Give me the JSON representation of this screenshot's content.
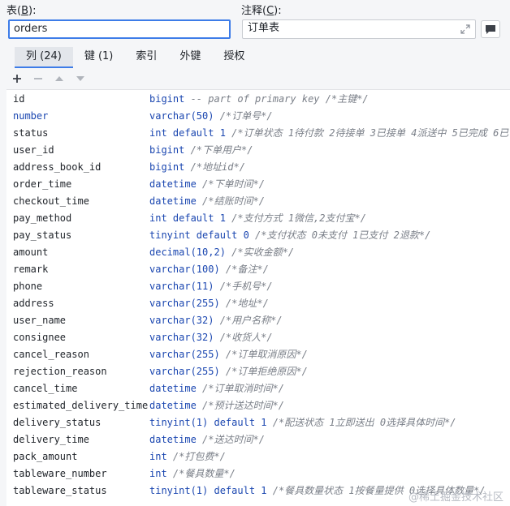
{
  "table_label_prefix": "表(",
  "table_label_key": "B",
  "table_label_suffix": "):",
  "comment_label_prefix": "注释(",
  "comment_label_key": "C",
  "comment_label_suffix": "):",
  "table_value": "orders",
  "comment_value": "订单表",
  "tabs": [
    {
      "label": "列 (24)",
      "active": true
    },
    {
      "label": "键 (1)"
    },
    {
      "label": "索引"
    },
    {
      "label": "外键"
    },
    {
      "label": "授权"
    }
  ],
  "toolbar": [
    "add-icon",
    "remove-icon",
    "move-up-icon",
    "move-down-icon"
  ],
  "columns": [
    {
      "name": "id",
      "type": "bigint",
      "extra": " -- part of primary key",
      "comment": " /*主键*/"
    },
    {
      "name": "number",
      "type": "varchar(50)",
      "extra": "",
      "comment": " /*订单号*/",
      "blue": true
    },
    {
      "name": "status",
      "type": "int default 1",
      "extra": "",
      "comment": " /*订单状态 1待付款 2待接单 3已接单 4派送中 5已完成 6已"
    },
    {
      "name": "user_id",
      "type": "bigint",
      "extra": "",
      "comment": " /*下单用户*/"
    },
    {
      "name": "address_book_id",
      "type": "bigint",
      "extra": "",
      "comment": " /*地址id*/"
    },
    {
      "name": "order_time",
      "type": "datetime",
      "extra": "",
      "comment": " /*下单时间*/"
    },
    {
      "name": "checkout_time",
      "type": "datetime",
      "extra": "",
      "comment": " /*结账时间*/"
    },
    {
      "name": "pay_method",
      "type": "int default 1",
      "extra": "",
      "comment": " /*支付方式 1微信,2支付宝*/"
    },
    {
      "name": "pay_status",
      "type": "tinyint default 0",
      "extra": "",
      "comment": " /*支付状态 0未支付 1已支付 2退款*/"
    },
    {
      "name": "amount",
      "type": "decimal(10,2)",
      "extra": "",
      "comment": " /*实收金额*/"
    },
    {
      "name": "remark",
      "type": "varchar(100)",
      "extra": "",
      "comment": " /*备注*/"
    },
    {
      "name": "phone",
      "type": "varchar(11)",
      "extra": "",
      "comment": " /*手机号*/"
    },
    {
      "name": "address",
      "type": "varchar(255)",
      "extra": "",
      "comment": " /*地址*/"
    },
    {
      "name": "user_name",
      "type": "varchar(32)",
      "extra": "",
      "comment": " /*用户名称*/"
    },
    {
      "name": "consignee",
      "type": "varchar(32)",
      "extra": "",
      "comment": " /*收货人*/"
    },
    {
      "name": "cancel_reason",
      "type": "varchar(255)",
      "extra": "",
      "comment": " /*订单取消原因*/"
    },
    {
      "name": "rejection_reason",
      "type": "varchar(255)",
      "extra": "",
      "comment": " /*订单拒绝原因*/"
    },
    {
      "name": "cancel_time",
      "type": "datetime",
      "extra": "",
      "comment": " /*订单取消时间*/"
    },
    {
      "name": "estimated_delivery_time",
      "type": "datetime",
      "extra": "",
      "comment": " /*预计送达时间*/"
    },
    {
      "name": "delivery_status",
      "type": "tinyint(1) default 1",
      "extra": "",
      "comment": " /*配送状态  1立即送出  0选择具体时间*/"
    },
    {
      "name": "delivery_time",
      "type": "datetime",
      "extra": "",
      "comment": " /*送达时间*/"
    },
    {
      "name": "pack_amount",
      "type": "int",
      "extra": "",
      "comment": " /*打包费*/"
    },
    {
      "name": "tableware_number",
      "type": "int",
      "extra": "",
      "comment": " /*餐具数量*/"
    },
    {
      "name": "tableware_status",
      "type": "tinyint(1) default 1",
      "extra": "",
      "comment": " /*餐具数量状态  1按餐量提供  0选择具体数量*/"
    }
  ],
  "watermark": "@稀土掘金技术社区"
}
